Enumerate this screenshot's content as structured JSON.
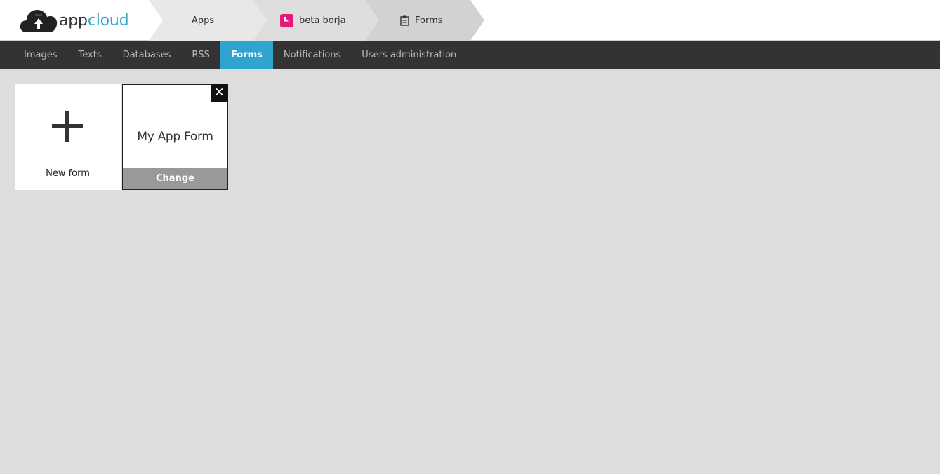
{
  "header": {
    "logo": {
      "part1": "app",
      "part2": "cloud"
    },
    "breadcrumbs": [
      {
        "label": "Apps"
      },
      {
        "label": "beta borja",
        "icon": "app-badge-icon",
        "badge_color": "#e8177a"
      },
      {
        "label": "Forms",
        "icon": "clipboard-icon"
      }
    ]
  },
  "nav": {
    "items": [
      "Images",
      "Texts",
      "Databases",
      "RSS",
      "Forms",
      "Notifications",
      "Users administration"
    ],
    "active": "Forms"
  },
  "cards": {
    "new_form": {
      "label": "New form",
      "icon": "plus-icon"
    },
    "forms": [
      {
        "title": "My App Form",
        "action": "Change",
        "close_glyph": "✕"
      }
    ]
  },
  "colors": {
    "accent": "#2fa4d0",
    "navbar": "#333333",
    "background": "#dddddd",
    "badge": "#e8177a"
  }
}
